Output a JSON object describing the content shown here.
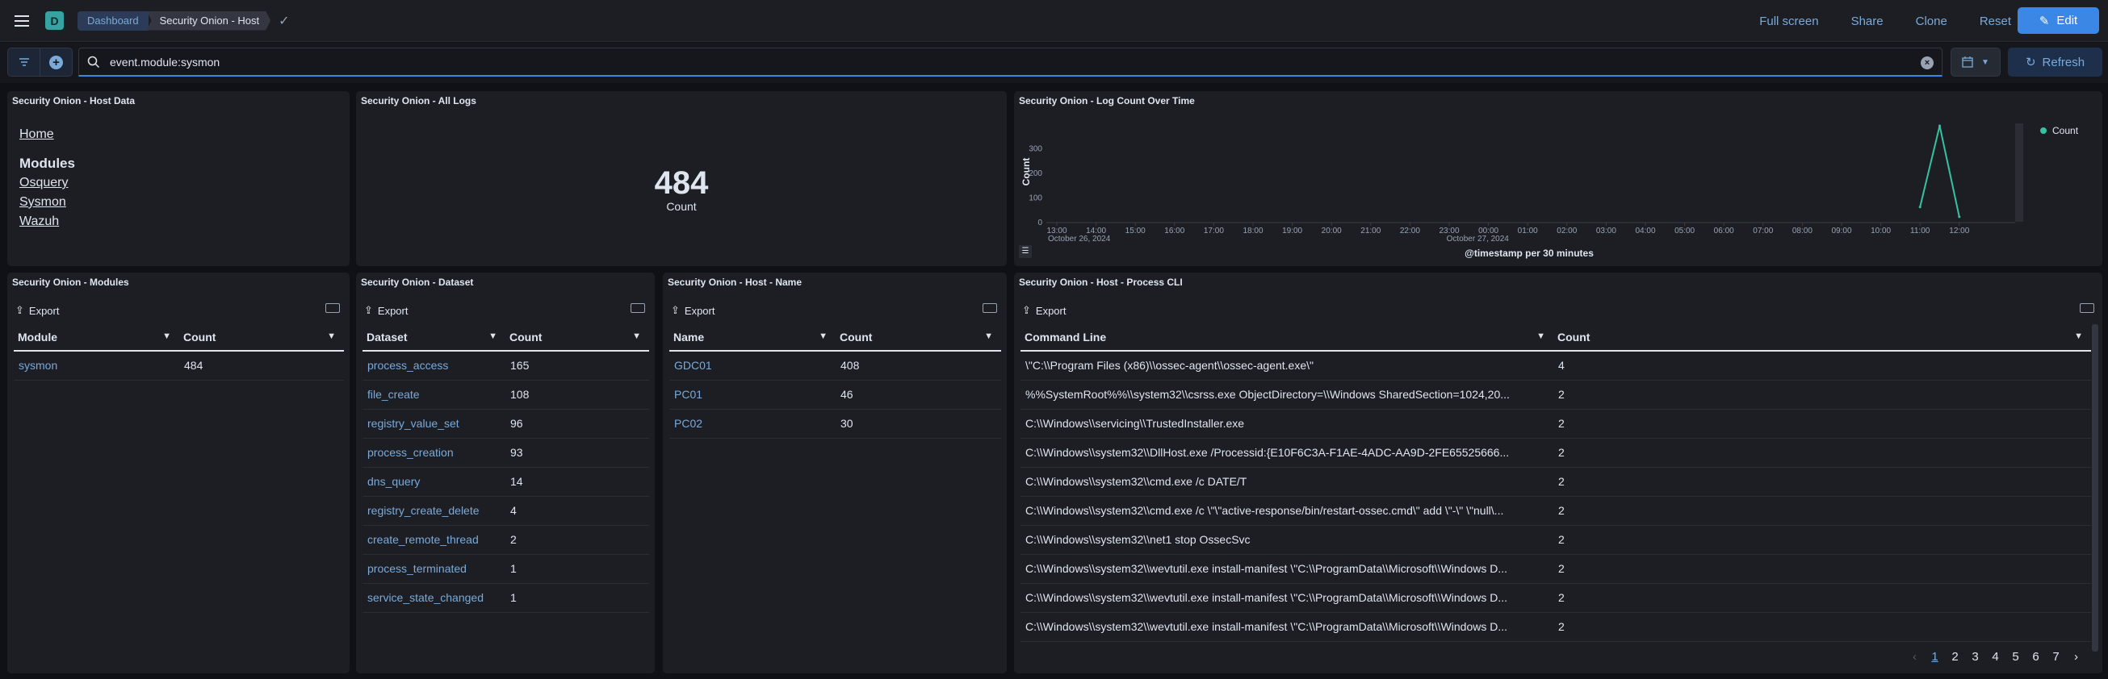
{
  "header": {
    "logo_letter": "D",
    "breadcrumb": [
      "Dashboard",
      "Security Onion - Host"
    ],
    "actions": [
      "Full screen",
      "Share",
      "Clone",
      "Reset"
    ],
    "edit_label": "Edit"
  },
  "query": {
    "value": "event.module:sysmon",
    "refresh_label": "Refresh"
  },
  "panels": {
    "host_data": {
      "title": "Security Onion - Host Data",
      "home": "Home",
      "modules_heading": "Modules",
      "links": [
        "Osquery",
        "Sysmon",
        "Wazuh"
      ]
    },
    "all_logs": {
      "title": "Security Onion - All Logs",
      "value": "484",
      "label": "Count"
    },
    "log_count": {
      "title": "Security Onion - Log Count Over Time",
      "x_title": "@timestamp per 30 minutes"
    },
    "modules": {
      "title": "Security Onion - Modules",
      "export": "Export",
      "columns": [
        "Module",
        "Count"
      ],
      "rows": [
        [
          "sysmon",
          "484"
        ]
      ]
    },
    "dataset": {
      "title": "Security Onion - Dataset",
      "export": "Export",
      "columns": [
        "Dataset",
        "Count"
      ],
      "rows": [
        [
          "process_access",
          "165"
        ],
        [
          "file_create",
          "108"
        ],
        [
          "registry_value_set",
          "96"
        ],
        [
          "process_creation",
          "93"
        ],
        [
          "dns_query",
          "14"
        ],
        [
          "registry_create_delete",
          "4"
        ],
        [
          "create_remote_thread",
          "2"
        ],
        [
          "process_terminated",
          "1"
        ],
        [
          "service_state_changed",
          "1"
        ]
      ]
    },
    "host_name": {
      "title": "Security Onion - Host - Name",
      "export": "Export",
      "columns": [
        "Name",
        "Count"
      ],
      "rows": [
        [
          "GDC01",
          "408"
        ],
        [
          "PC01",
          "46"
        ],
        [
          "PC02",
          "30"
        ]
      ]
    },
    "process_cli": {
      "title": "Security Onion - Host - Process CLI",
      "export": "Export",
      "columns": [
        "Command Line",
        "Count"
      ],
      "rows": [
        [
          "\\\"C:\\\\Program Files (x86)\\\\ossec-agent\\\\ossec-agent.exe\\\"",
          "4"
        ],
        [
          "%%SystemRoot%%\\\\system32\\\\csrss.exe ObjectDirectory=\\\\Windows SharedSection=1024,20...",
          "2"
        ],
        [
          "C:\\\\Windows\\\\servicing\\\\TrustedInstaller.exe",
          "2"
        ],
        [
          "C:\\\\Windows\\\\system32\\\\DllHost.exe /Processid:{E10F6C3A-F1AE-4ADC-AA9D-2FE65525666...",
          "2"
        ],
        [
          "C:\\\\Windows\\\\system32\\\\cmd.exe /c DATE/T",
          "2"
        ],
        [
          "C:\\\\Windows\\\\system32\\\\cmd.exe /c \\\"\\\"active-response/bin/restart-ossec.cmd\\\" add \\\"-\\\" \\\"null\\...",
          "2"
        ],
        [
          "C:\\\\Windows\\\\system32\\\\net1 stop OssecSvc",
          "2"
        ],
        [
          "C:\\\\Windows\\\\system32\\\\wevtutil.exe install-manifest \\\"C:\\\\ProgramData\\\\Microsoft\\\\Windows D...",
          "2"
        ],
        [
          "C:\\\\Windows\\\\system32\\\\wevtutil.exe install-manifest \\\"C:\\\\ProgramData\\\\Microsoft\\\\Windows D...",
          "2"
        ],
        [
          "C:\\\\Windows\\\\system32\\\\wevtutil.exe install-manifest \\\"C:\\\\ProgramData\\\\Microsoft\\\\Windows D...",
          "2"
        ]
      ],
      "pages": [
        "1",
        "2",
        "3",
        "4",
        "5",
        "6",
        "7"
      ],
      "current_page": "1"
    }
  },
  "chart_data": {
    "type": "line",
    "title": "",
    "xlabel": "@timestamp per 30 minutes",
    "ylabel": "Count",
    "ylim": [
      0,
      400
    ],
    "yticks": [
      "0",
      "100",
      "200",
      "300"
    ],
    "xticks": [
      "13:00",
      "14:00",
      "15:00",
      "16:00",
      "17:00",
      "18:00",
      "19:00",
      "20:00",
      "21:00",
      "22:00",
      "23:00",
      "00:00",
      "01:00",
      "02:00",
      "03:00",
      "04:00",
      "05:00",
      "06:00",
      "07:00",
      "08:00",
      "09:00",
      "10:00",
      "11:00",
      "12:00"
    ],
    "date_labels": [
      "October 26, 2024",
      "October 27, 2024"
    ],
    "grid": false,
    "legend_position": "top-right",
    "series": [
      {
        "name": "Count",
        "color": "#36c2a2",
        "x": [
          "11:00",
          "11:30",
          "12:00"
        ],
        "values": [
          60,
          390,
          20
        ]
      }
    ]
  }
}
